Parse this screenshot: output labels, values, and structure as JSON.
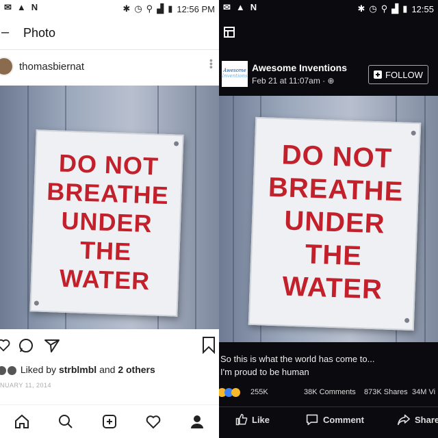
{
  "left": {
    "status": {
      "notif_icons": [
        "gmail-icon",
        "triangle-icon",
        "n-icon"
      ],
      "time": "12:56 PM"
    },
    "header": {
      "back_label": "–",
      "title": "Photo"
    },
    "post": {
      "username": "thomasbiernat",
      "sign_lines": [
        "DO NOT",
        "BREATHE",
        "UNDER",
        "THE",
        "WATER"
      ],
      "liked_by_prefix": "Liked by",
      "liked_user": "strblmbl",
      "liked_and": "and",
      "liked_others": "2 others",
      "date": "NUARY 11, 2014"
    },
    "bottom_nav": [
      "home-icon",
      "search-icon",
      "add-icon",
      "heart-icon",
      "profile-icon"
    ]
  },
  "right": {
    "status": {
      "notif_icons": [
        "gmail-icon",
        "triangle-icon",
        "n-icon"
      ],
      "time": "12:55"
    },
    "page": {
      "logo_line1": "Awesome",
      "logo_line2": "Inventions",
      "name": "Awesome Inventions",
      "date": "Feb 21 at 11:07am · ",
      "follow_label": "FOLLOW"
    },
    "sign_lines": [
      "DO NOT",
      "BREATHE",
      "UNDER",
      "THE",
      "WATER"
    ],
    "caption_line1": "So this is what the world has come to...",
    "caption_line2": "I'm proud to be human",
    "stats": {
      "reactions": "255K",
      "comments": "38K Comments",
      "shares": "873K Shares",
      "views": "34M Vi"
    },
    "actions": {
      "like": "Like",
      "comment": "Comment",
      "share": "Share"
    }
  },
  "colors": {
    "sign_red": "#c2202b",
    "fb_dark": "#0b0b0f",
    "ig_white": "#ffffff"
  }
}
